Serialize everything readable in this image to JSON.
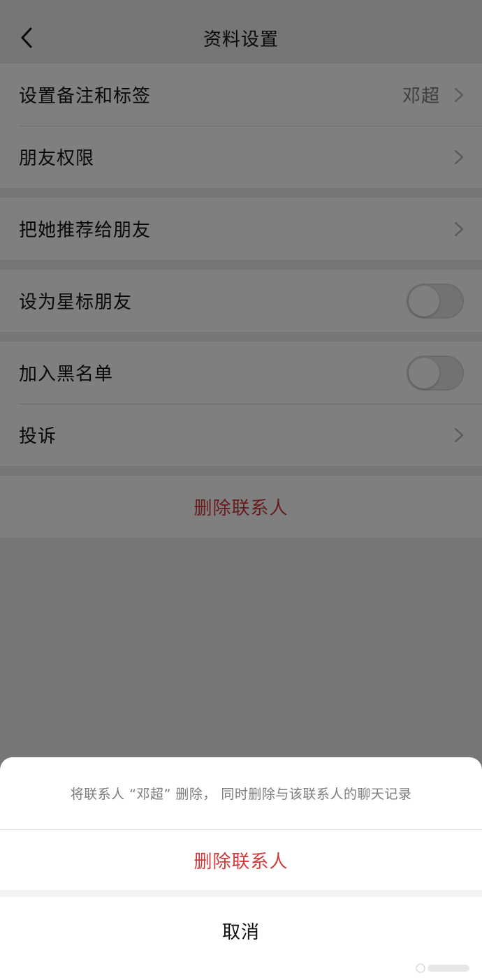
{
  "navbar": {
    "title": "资料设置",
    "back_icon": "chevron-left-icon"
  },
  "settings": {
    "remark_tags": {
      "label": "设置备注和标签",
      "value": "邓超"
    },
    "friend_permissions": {
      "label": "朋友权限"
    },
    "recommend_to_friend": {
      "label": "把她推荐给朋友"
    },
    "star_friend": {
      "label": "设为星标朋友",
      "enabled": false
    },
    "blacklist": {
      "label": "加入黑名单",
      "enabled": false
    },
    "complain": {
      "label": "投诉"
    },
    "delete_contact": {
      "label": "删除联系人"
    }
  },
  "action_sheet": {
    "description": "将联系人 “邓超” 删除， 同时删除与该联系人的聊天记录",
    "delete_label": "删除联系人",
    "cancel_label": "取消"
  },
  "colors": {
    "danger": "#d03a3a",
    "background": "#ededed",
    "overlay": "rgba(0,0,0,0.5)"
  }
}
